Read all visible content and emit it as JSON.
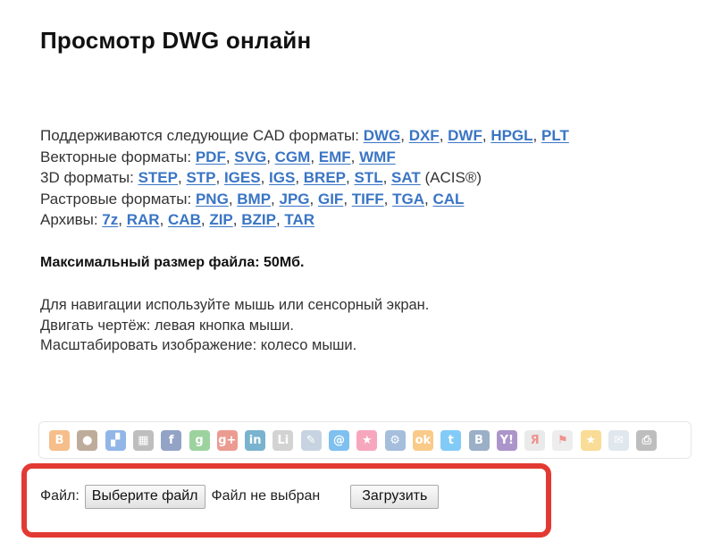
{
  "page": {
    "title": "Просмотр DWG онлайн"
  },
  "formats": {
    "cad": {
      "label": "Поддерживаются следующие CAD форматы: ",
      "links": [
        "DWG",
        "DXF",
        "DWF",
        "HPGL",
        "PLT"
      ]
    },
    "vector": {
      "label": "Векторные форматы: ",
      "links": [
        "PDF",
        "SVG",
        "CGM",
        "EMF",
        "WMF"
      ]
    },
    "three_d": {
      "label": "3D форматы: ",
      "links": [
        "STEP",
        "STP",
        "IGES",
        "IGS",
        "BREP",
        "STL",
        "SAT"
      ],
      "suffix": " (ACIS®)"
    },
    "raster": {
      "label": "Растровые форматы: ",
      "links": [
        "PNG",
        "BMP",
        "JPG",
        "GIF",
        "TIFF",
        "TGA",
        "CAL"
      ]
    },
    "archives": {
      "label": "Архивы: ",
      "links": [
        "7z",
        "RAR",
        "CAB",
        "ZIP",
        "BZIP",
        "TAR"
      ]
    },
    "separator": ", "
  },
  "max_size": "Максимальный размер файла: 50Мб.",
  "help": {
    "line1": "Для навигации используйте мышь или сенсорный экран.",
    "line2": "Двигать чертёж: левая кнопка мыши.",
    "line3": "Масштабировать изображение: колесо мыши."
  },
  "share": {
    "icons": [
      {
        "name": "blogger-icon",
        "glyph": "B",
        "color": "#f08a2c"
      },
      {
        "name": "digg-icon",
        "glyph": "●",
        "color": "#8a6a4a"
      },
      {
        "name": "delicious-icon",
        "glyph": "▞",
        "color": "#3a7bd5"
      },
      {
        "name": "myspace-icon",
        "glyph": "▦",
        "color": "#8a8a8a"
      },
      {
        "name": "facebook-icon",
        "glyph": "f",
        "color": "#3b5998"
      },
      {
        "name": "google-icon",
        "glyph": "g",
        "color": "#4caf50"
      },
      {
        "name": "google-plus-icon",
        "glyph": "g+",
        "color": "#dd4b39"
      },
      {
        "name": "linkedin-icon",
        "glyph": "in",
        "color": "#0e76a8"
      },
      {
        "name": "liveinternet-icon",
        "glyph": "Li",
        "color": "#b0b0b0"
      },
      {
        "name": "livejournal-icon",
        "glyph": "✎",
        "color": "#9ab0c8"
      },
      {
        "name": "mail-ru-icon",
        "glyph": "@",
        "color": "#168de2"
      },
      {
        "name": "favorites-pink-icon",
        "glyph": "★",
        "color": "#f0608a"
      },
      {
        "name": "settings-icon",
        "glyph": "⚙",
        "color": "#5c8ac0"
      },
      {
        "name": "odnoklassniki-icon",
        "glyph": "ok",
        "color": "#f5a02a"
      },
      {
        "name": "twitter-icon",
        "glyph": "t",
        "color": "#1da1f2"
      },
      {
        "name": "vkontakte-icon",
        "glyph": "B",
        "color": "#4a6e9a"
      },
      {
        "name": "yahoo-icon",
        "glyph": "Y!",
        "color": "#6a3fa0"
      },
      {
        "name": "yandex-icon",
        "glyph": "Я",
        "color": "#d9d9d9",
        "fg": "#e23a33"
      },
      {
        "name": "surfingbird-icon",
        "glyph": "⚑",
        "color": "#e0e0e0",
        "fg": "#e23a33"
      },
      {
        "name": "bookmark-star-icon",
        "glyph": "★",
        "color": "#f5c040"
      },
      {
        "name": "email-icon",
        "glyph": "✉",
        "color": "#c8d4e0"
      },
      {
        "name": "print-icon",
        "glyph": "⎙",
        "color": "#8a8a8a"
      }
    ]
  },
  "upload": {
    "file_label": "Файл:",
    "choose_button": "Выберите файл",
    "no_file_text": "Файл не выбран",
    "submit_button": "Загрузить",
    "highlight_color": "#e23a33"
  }
}
